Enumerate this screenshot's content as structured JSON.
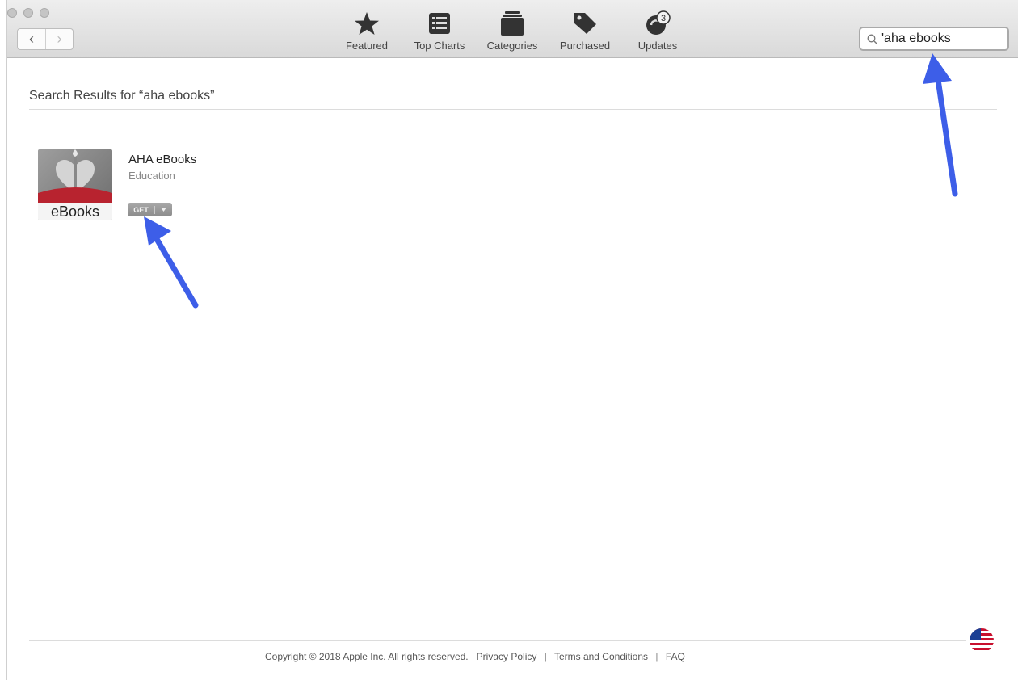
{
  "toolbar": {
    "items": [
      {
        "label": "Featured",
        "icon": "star-icon"
      },
      {
        "label": "Top Charts",
        "icon": "list-icon"
      },
      {
        "label": "Categories",
        "icon": "stack-icon"
      },
      {
        "label": "Purchased",
        "icon": "tag-icon"
      },
      {
        "label": "Updates",
        "icon": "updates-icon",
        "badge": "3"
      }
    ]
  },
  "search": {
    "value": "'aha ebooks",
    "icon": "search-icon"
  },
  "results": {
    "title": "Search Results for “aha ebooks”",
    "items": [
      {
        "name": "AHA  eBooks",
        "category": "Education",
        "icon_text": "eBooks",
        "button_label": "GET"
      }
    ]
  },
  "footer": {
    "copyright": "Copyright © 2018 Apple Inc. All rights reserved.",
    "privacy": "Privacy Policy",
    "separator": "|",
    "terms": "Terms and Conditions",
    "faq": "FAQ"
  },
  "colors": {
    "annotation_arrow": "#3d5ee8",
    "icon_band": "#b8232f"
  }
}
